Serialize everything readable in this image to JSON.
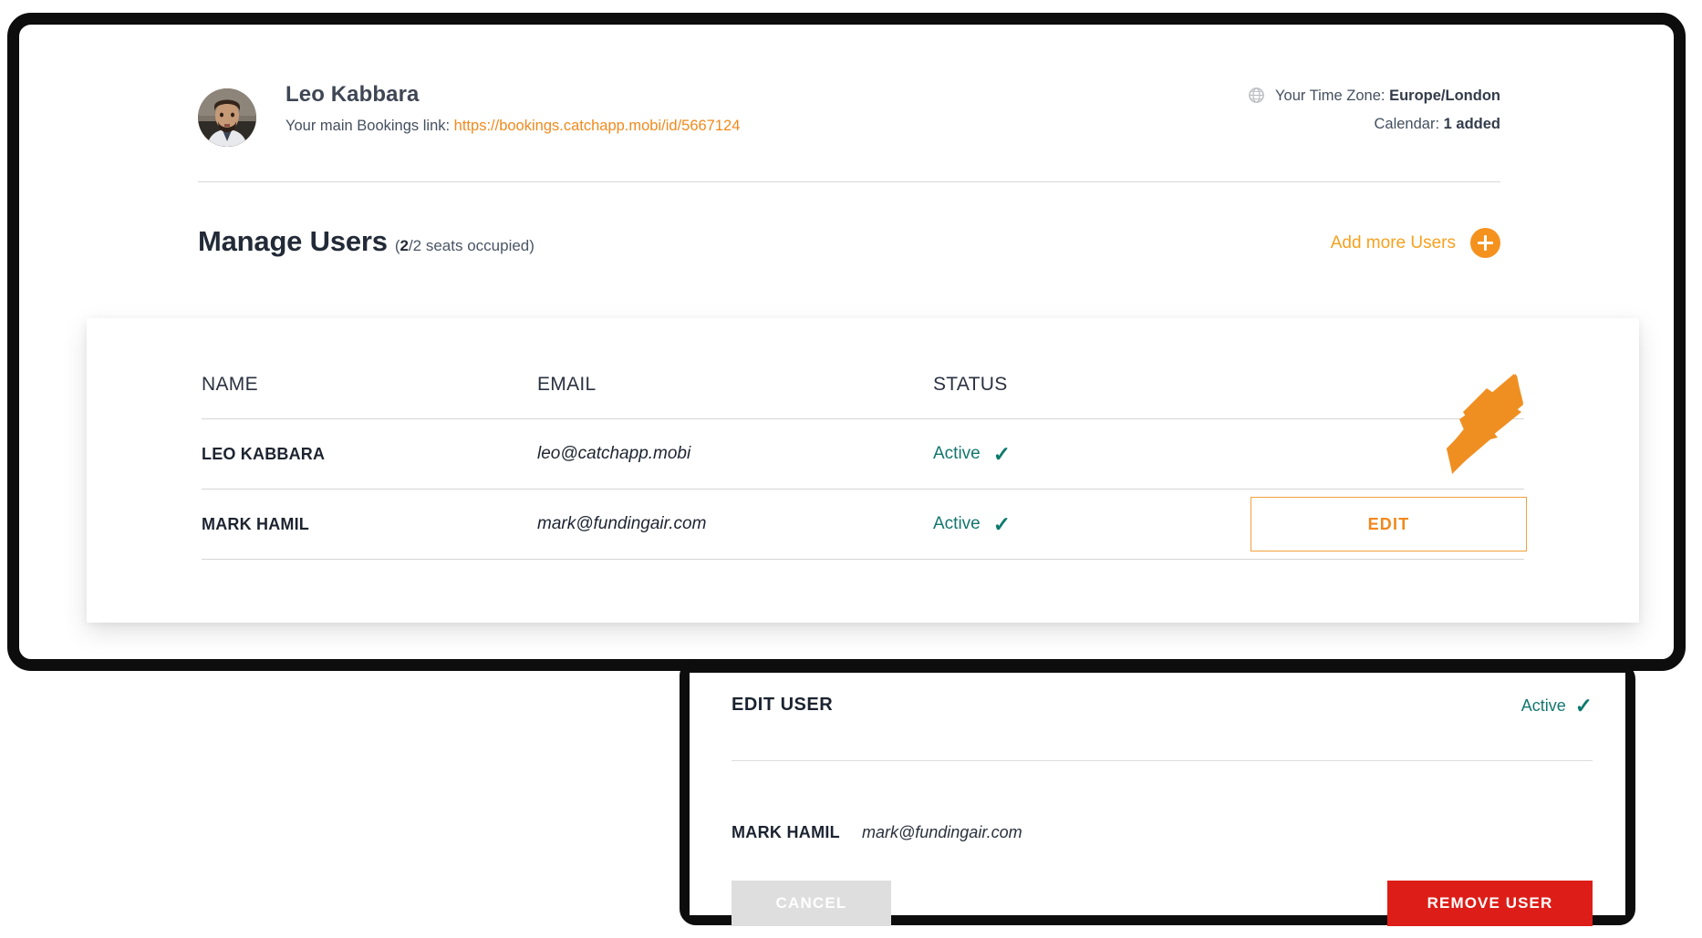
{
  "profile": {
    "name": "Leo Kabbara",
    "link_prefix": "Your main Bookings link:",
    "link_text": "https://bookings.catchapp.mobi/id/5667124",
    "timezone_label": "Your Time Zone:",
    "timezone_value": "Europe/London",
    "calendar_label": "Calendar:",
    "calendar_value": "1 added",
    "globe_icon": "globe-icon"
  },
  "page": {
    "title": "Manage Users",
    "seats_count": "2",
    "seats_suffix": "/2 seats occupied)",
    "seats_prefix": "(",
    "add_users_label": "Add more Users",
    "add_icon": "plus-icon"
  },
  "table": {
    "columns": [
      "NAME",
      "EMAIL",
      "STATUS"
    ],
    "rows": [
      {
        "name": "LEO KABBARA",
        "email": "leo@catchapp.mobi",
        "status": "Active",
        "status_tick": "✓",
        "action": ""
      },
      {
        "name": "MARK HAMIL",
        "email": "mark@fundingair.com",
        "status": "Active",
        "status_tick": "✓",
        "action": "EDIT"
      }
    ]
  },
  "dialog": {
    "title": "EDIT USER",
    "status": "Active",
    "status_tick": "✓",
    "user_name": "MARK HAMIL",
    "user_email": "mark@fundingair.com",
    "cancel_label": "CANCEL",
    "remove_label": "REMOVE USER"
  },
  "annotation": {
    "arrow": "arrow-pointer",
    "arrow_color": "#ef8f22"
  },
  "colors": {
    "accent_orange": "#f0881e",
    "status_green": "#13766e",
    "danger_red": "#dd1d17",
    "frame_black": "#0d0d0d",
    "cancel_gray": "#dedede"
  }
}
